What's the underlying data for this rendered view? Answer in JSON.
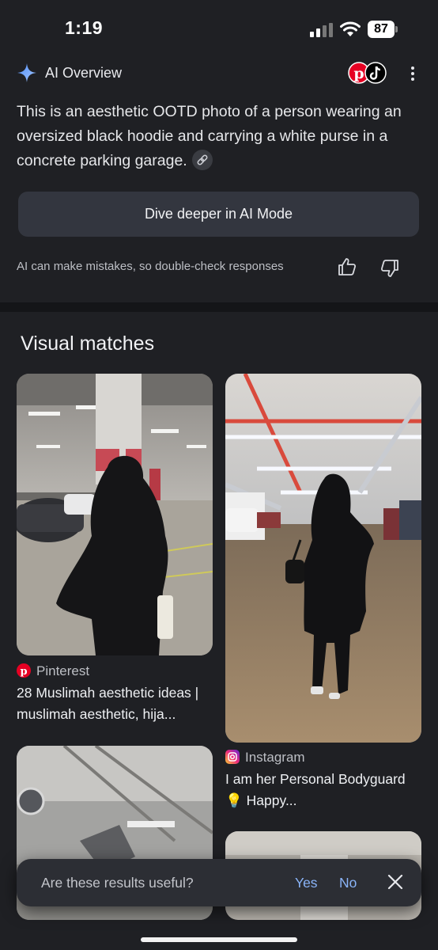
{
  "status": {
    "time": "1:19",
    "battery": "87"
  },
  "ai_overview": {
    "title": "AI Overview",
    "text": "This is an aesthetic OOTD photo of a person wearing an oversized black hoodie and carrying a white purse in a concrete parking garage.",
    "dive_button": "Dive deeper in AI Mode",
    "disclaimer": "AI can make mistakes, so double-check responses"
  },
  "visual_matches": {
    "title": "Visual matches",
    "cards": [
      {
        "source": "Pinterest",
        "title": "28 Muslimah aesthetic ideas | muslimah aesthetic, hija..."
      },
      {
        "source": "Instagram",
        "title": "I am her Personal Bodyguard 💡 Happy..."
      }
    ]
  },
  "feedback": {
    "question": "Are these results useful?",
    "yes": "Yes",
    "no": "No"
  },
  "colors": {
    "background": "#1f2024",
    "accent": "#8ab4f8",
    "button": "#33363f",
    "pinterest": "#e60023"
  },
  "icons": [
    "signal-icon",
    "wifi-icon",
    "ai-spark-icon",
    "pinterest-icon",
    "tiktok-icon",
    "more-icon",
    "link-icon",
    "thumbs-up-icon",
    "thumbs-down-icon",
    "instagram-icon",
    "close-icon"
  ]
}
